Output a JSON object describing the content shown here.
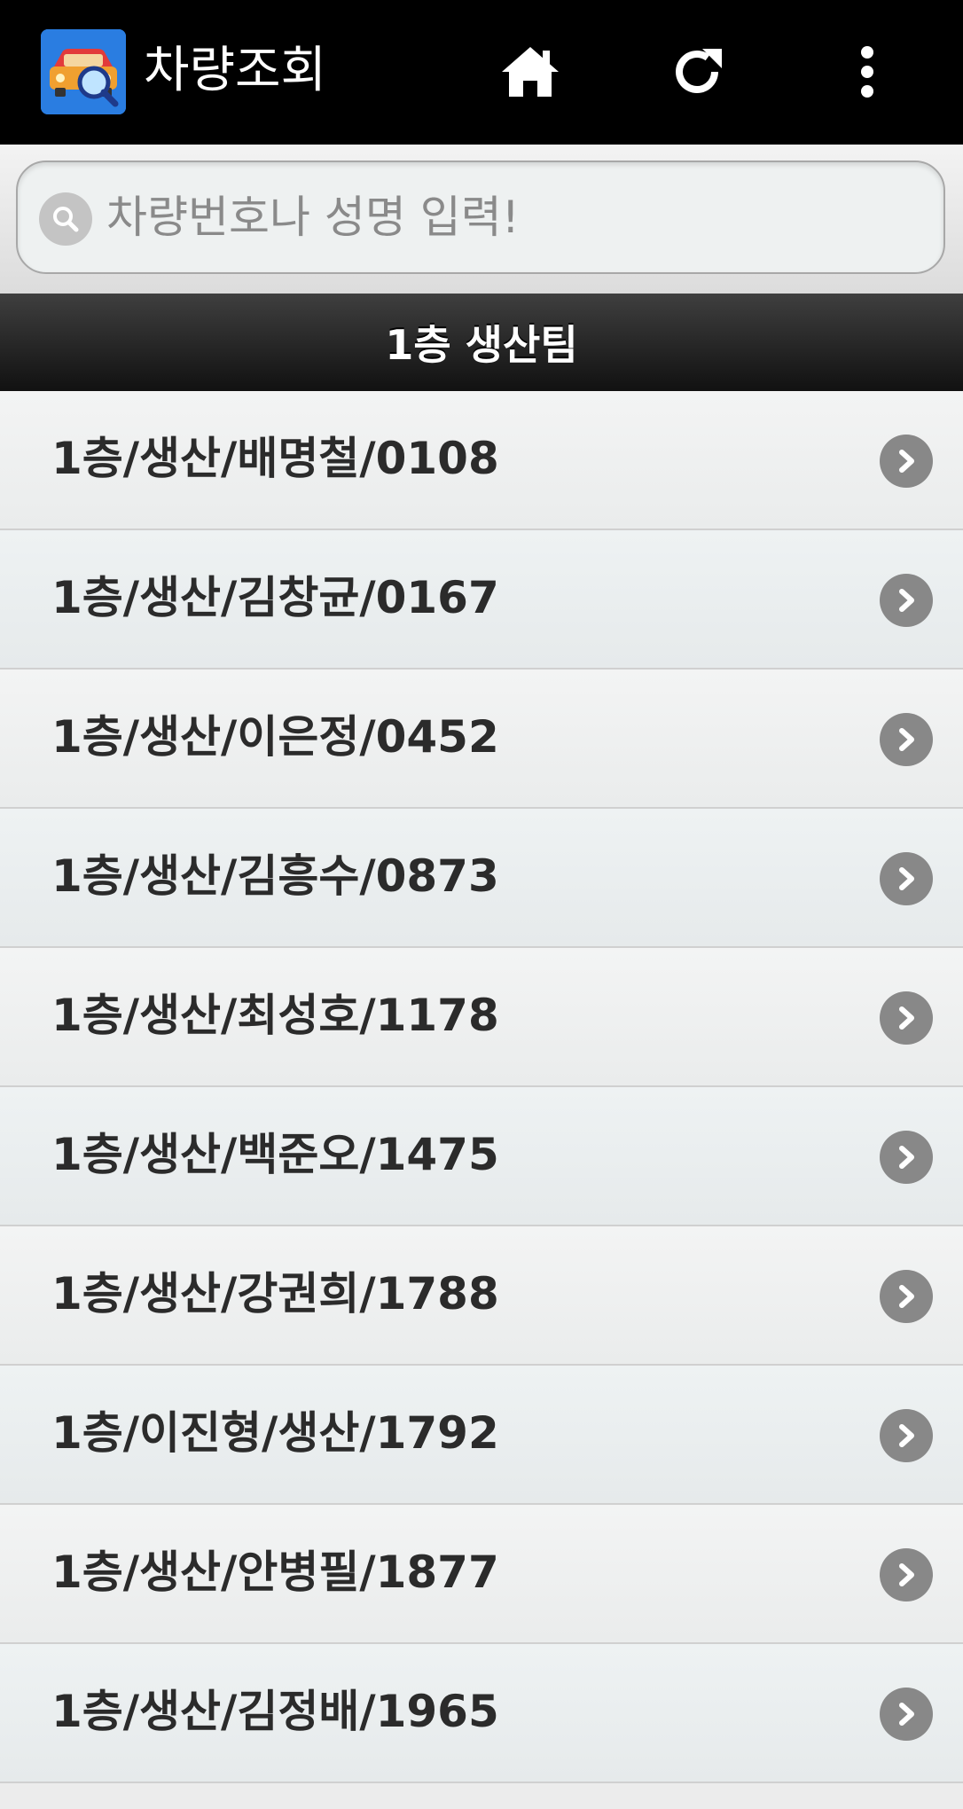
{
  "app": {
    "title": "차량조회",
    "icon": "car-search-icon"
  },
  "action_bar": {
    "home_icon": "home-icon",
    "refresh_icon": "refresh-icon",
    "overflow_icon": "more-vertical-icon",
    "background_color": "#000000"
  },
  "search": {
    "placeholder": "차량번호나 성명 입력!",
    "value": ""
  },
  "list": {
    "divider_label": "1층 생산팀",
    "items": [
      {
        "label": "1층/생산/배명철/0108"
      },
      {
        "label": "1층/생산/김창균/0167"
      },
      {
        "label": "1층/생산/이은정/0452"
      },
      {
        "label": "1층/생산/김흥수/0873"
      },
      {
        "label": "1층/생산/최성호/1178"
      },
      {
        "label": "1층/생산/백준오/1475"
      },
      {
        "label": "1층/생산/강권희/1788"
      },
      {
        "label": "1층/이진형/생산/1792"
      },
      {
        "label": "1층/생산/안병필/1877"
      },
      {
        "label": "1층/생산/김정배/1965"
      }
    ]
  }
}
